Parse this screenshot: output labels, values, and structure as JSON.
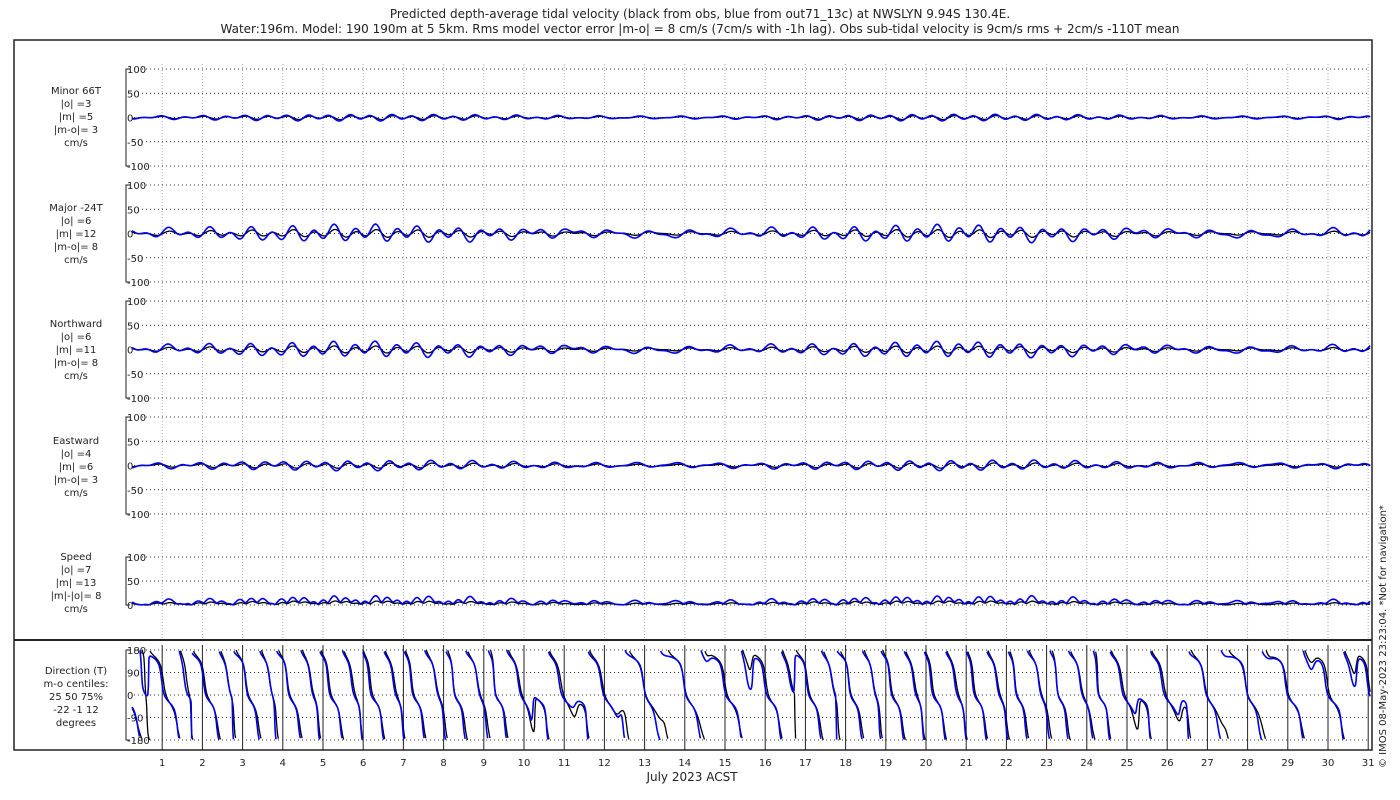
{
  "chart_data": {
    "type": "line",
    "title": [
      "Predicted depth-average tidal velocity (black from obs, blue from out71_13c) at NWSLYN 9.94S 130.4E.",
      "Water:196m. Model: 190 190m at 5 5km. Rms model vector error |m-o| = 8 cm/s (7cm/s with -1h lag). Obs sub-tidal velocity is 9cm/s rms + 2cm/s -110T mean"
    ],
    "xlabel": "July 2023 ACST",
    "xlim": [
      0.25,
      31.05
    ],
    "xticks": [
      "1",
      "2",
      "3",
      "4",
      "5",
      "6",
      "7",
      "8",
      "9",
      "10",
      "11",
      "12",
      "13",
      "14",
      "15",
      "16",
      "17",
      "18",
      "19",
      "20",
      "21",
      "22",
      "23",
      "24",
      "25",
      "26",
      "27",
      "28",
      "29",
      "30",
      "31"
    ],
    "series_colors": {
      "obs": "#000000",
      "model": "#0000ee"
    },
    "panels": [
      {
        "id": "minor",
        "label": [
          "Minor 66T",
          "|o| =3",
          "|m| =5",
          "|m-o|= 3",
          "cm/s"
        ],
        "ylim": [
          -100,
          100
        ],
        "yticks": [
          "100",
          "50",
          "0",
          "-50",
          "-100"
        ],
        "obs_amp": 3,
        "model_amp": 5
      },
      {
        "id": "major",
        "label": [
          "Major -24T",
          "|o| =6",
          "|m| =12",
          "|m-o|= 8",
          "cm/s"
        ],
        "ylim": [
          -100,
          100
        ],
        "yticks": [
          "100",
          "50",
          "0",
          "-50",
          "-100"
        ],
        "obs_amp": 6,
        "model_amp": 12
      },
      {
        "id": "north",
        "label": [
          "Northward",
          "|o| =6",
          "|m| =11",
          "|m-o|= 8",
          "cm/s"
        ],
        "ylim": [
          -100,
          100
        ],
        "yticks": [
          "100",
          "50",
          "0",
          "-50",
          "-100"
        ],
        "obs_amp": 6,
        "model_amp": 11
      },
      {
        "id": "east",
        "label": [
          "Eastward",
          "|o| =4",
          "|m| =6",
          "|m-o|= 3",
          "cm/s"
        ],
        "ylim": [
          -100,
          100
        ],
        "yticks": [
          "100",
          "50",
          "0",
          "-50",
          "-100"
        ],
        "obs_amp": 4,
        "model_amp": 6
      },
      {
        "id": "speed",
        "label": [
          "Speed",
          "|o| =7",
          "|m| =13",
          "|m|-|o|= 8",
          "cm/s"
        ],
        "ylim": [
          0,
          100
        ],
        "yticks": [
          "100",
          "50",
          "0"
        ],
        "obs_amp": 7,
        "model_amp": 13
      },
      {
        "id": "dir",
        "label": [
          "Direction (T)",
          "m-o centiles:",
          "25  50  75%",
          "-22  -1  12",
          "degrees"
        ],
        "ylim": [
          -180,
          180
        ],
        "yticks": [
          "180",
          "90",
          "0",
          "-90",
          "-180"
        ]
      }
    ],
    "credit": "© IMOS 08-May-2023 23:23:04. *Not for navigation*"
  }
}
